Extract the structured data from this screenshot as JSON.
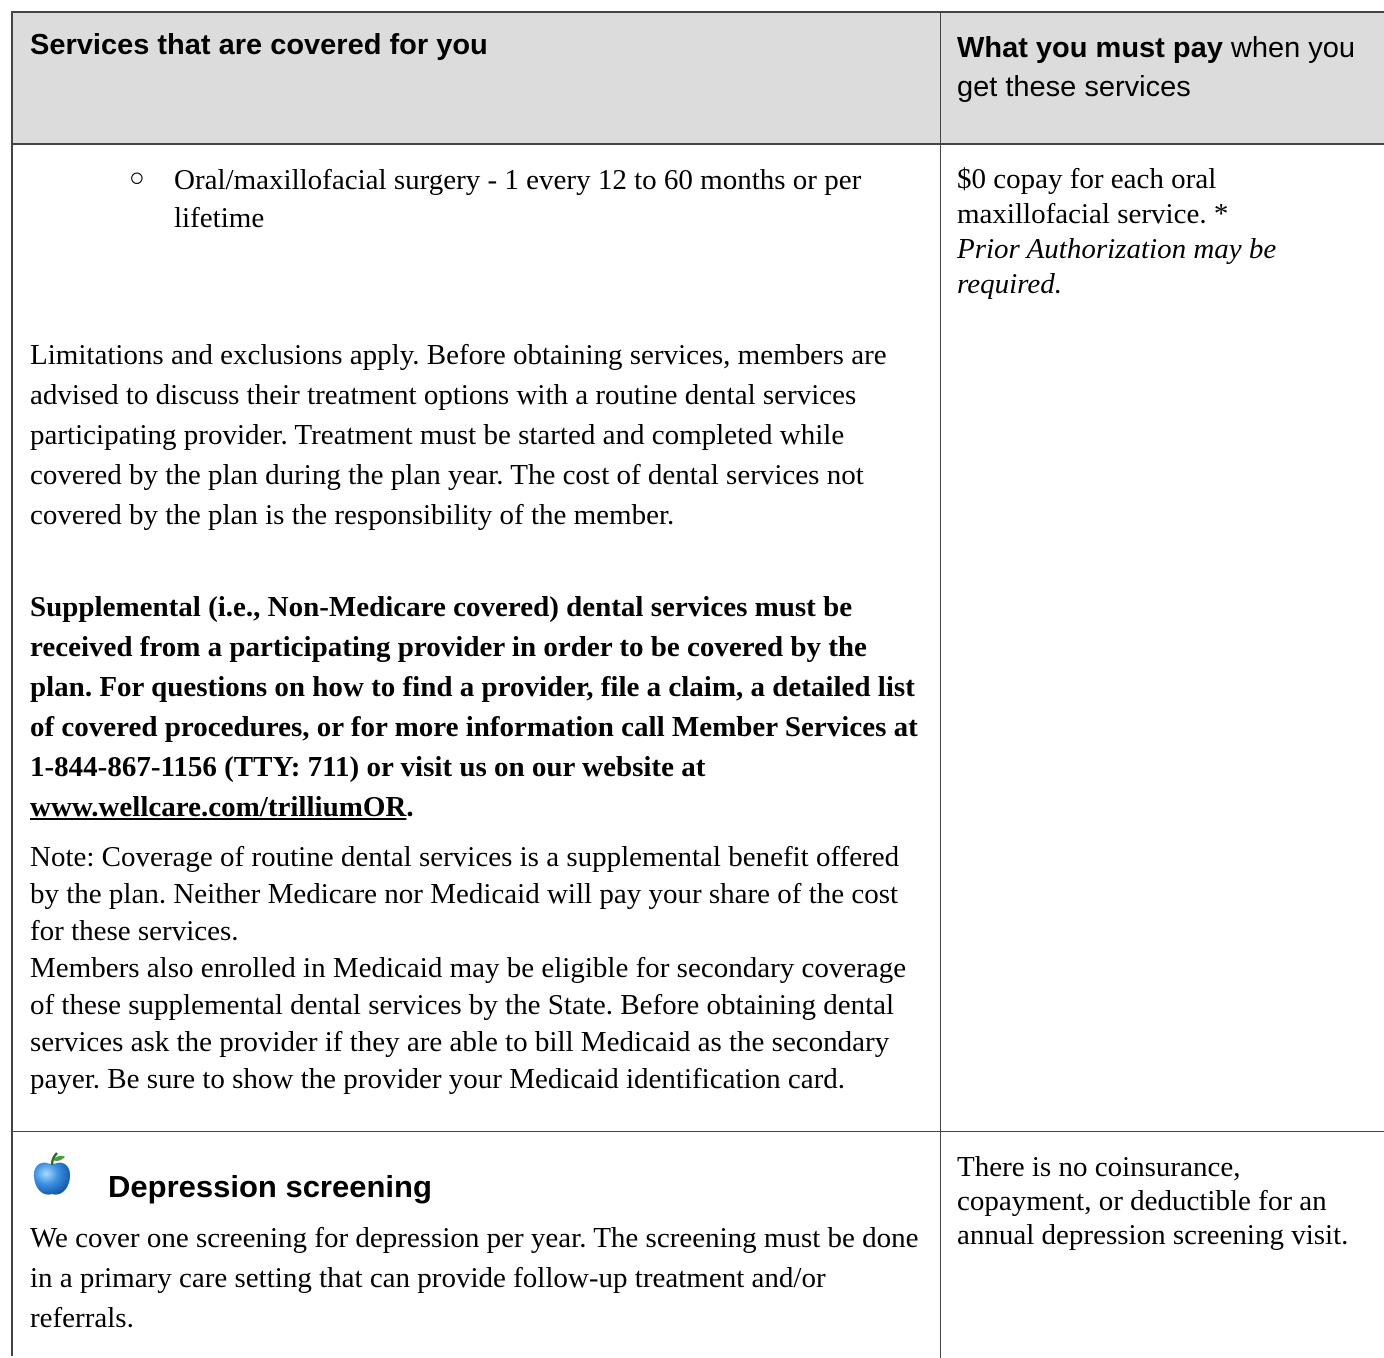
{
  "table": {
    "header": {
      "left": "Services that are covered for you",
      "right_bold": "What you must pay",
      "right_rest": " when you get these services"
    },
    "row1": {
      "bullet_symbol": "○",
      "bullet_text": "Oral/maxillofacial surgery  - 1 every 12 to 60 months or per lifetime",
      "limitations": "Limitations and exclusions apply. Before obtaining services, members are advised to discuss their treatment options with a routine dental services participating provider. Treatment must be started and completed while covered by the plan during the plan year. The cost of dental services not covered by the plan is the responsibility of the member.",
      "supplemental_text": "Supplemental (i.e., Non-Medicare covered) dental services must be received from a participating provider in order to be covered by the plan. For questions on how to find a provider, file a claim, a detailed list of covered procedures, or for more information call Member Services at 1-844-867-1156 (TTY: 711) or visit us on our website at ",
      "supplemental_link": "www.wellcare.com/trilliumOR",
      "supplemental_end": ".",
      "note1": "Note: Coverage of routine dental services is a supplemental benefit offered by the plan. Neither Medicare nor Medicaid will pay your share of the cost for these services.",
      "note2": "Members also enrolled in Medicaid may be eligible for secondary coverage of these supplemental dental services by the State. Before obtaining dental services ask the provider if they are able to bill Medicaid as the secondary payer. Be sure to show the provider your Medicaid identification card.",
      "pay_text": "$0 copay for each oral maxillofacial service. *",
      "pay_italic": "Prior Authorization may be required."
    },
    "row2": {
      "icon": "apple-icon",
      "title": "Depression screening",
      "body": "We cover one screening for depression per year. The screening must be done in a primary care setting that can provide follow-up treatment and/or referrals.",
      "pay_text": "There is no coinsurance, copayment, or deductible for an annual depression screening visit."
    }
  }
}
